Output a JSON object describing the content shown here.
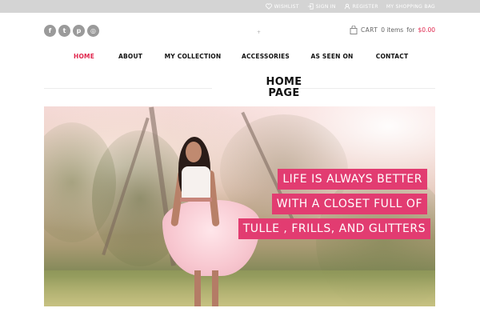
{
  "topbar": {
    "links": [
      {
        "label": "WISHLIST",
        "icon": "heart-icon"
      },
      {
        "label": "SIGN IN",
        "icon": "sign-in-icon"
      },
      {
        "label": "REGISTER",
        "icon": "user-icon"
      },
      {
        "label": "MY SHOPPING BAG",
        "icon": ""
      }
    ]
  },
  "social": [
    {
      "glyph": "f",
      "icon": "facebook-icon"
    },
    {
      "glyph": "t",
      "icon": "twitter-icon"
    },
    {
      "glyph": "p",
      "icon": "pinterest-icon"
    },
    {
      "glyph": "◎",
      "icon": "instagram-icon"
    }
  ],
  "center_marker": "+",
  "cart": {
    "label": "CART",
    "items": "0 items",
    "for": "for",
    "price": "$0.00",
    "icon": "shopping-bag-icon"
  },
  "nav": {
    "items": [
      {
        "label": "HOME",
        "active": true
      },
      {
        "label": "ABOUT",
        "active": false
      },
      {
        "label": "MY COLLECTION",
        "active": false
      },
      {
        "label": "ACCESSORIES",
        "active": false
      },
      {
        "label": "AS SEEN ON",
        "active": false
      },
      {
        "label": "CONTACT",
        "active": false
      }
    ]
  },
  "page": {
    "heading_line1": "HOME",
    "heading_line2": "PAGE"
  },
  "hero": {
    "lines": [
      "LIFE IS ALWAYS BETTER",
      "WITH A CLOSET FULL OF",
      "TULLE , FRILLS, AND GLITTERS"
    ]
  },
  "colors": {
    "accent": "#e0264d",
    "tagline_bg": "#e23c71",
    "topbar_bg": "#d4d4d4"
  }
}
